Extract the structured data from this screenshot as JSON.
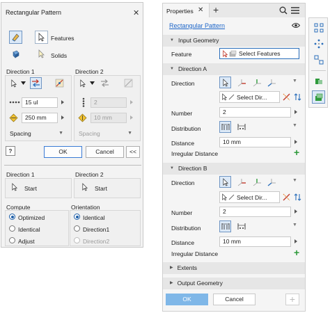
{
  "dialog": {
    "title": "Rectangular Pattern",
    "features_label": "Features",
    "solids_label": "Solids",
    "direction1": {
      "label": "Direction 1",
      "count": "15 ul",
      "spacing": "250 mm",
      "method": "Spacing"
    },
    "direction2": {
      "label": "Direction 2",
      "count": "2",
      "spacing": "10 mm",
      "method": "Spacing"
    },
    "ok_label": "OK",
    "cancel_label": "Cancel",
    "more_label": "<<",
    "start_dir1": {
      "label": "Direction 1",
      "start": "Start"
    },
    "start_dir2": {
      "label": "Direction 2",
      "start": "Start"
    },
    "compute": {
      "label": "Compute",
      "options": [
        "Optimized",
        "Identical",
        "Adjust"
      ],
      "selected": 0
    },
    "orientation": {
      "label": "Orientation",
      "options": [
        "Identical",
        "Direction1",
        "Direction2"
      ],
      "selected": 0
    }
  },
  "properties": {
    "tab_label": "Properties",
    "panel_link": "Rectangular Pattern",
    "input_geometry": {
      "header": "Input Geometry",
      "feature_label": "Feature",
      "select_label": "Select Features"
    },
    "direction_a": {
      "header": "Direction A",
      "direction_label": "Direction",
      "select_dir": "Select Dir...",
      "number_label": "Number",
      "number": "2",
      "distribution_label": "Distribution",
      "distance_label": "Distance",
      "distance": "10 mm",
      "irregular_label": "Irregular Distance"
    },
    "direction_b": {
      "header": "Direction B",
      "direction_label": "Direction",
      "select_dir": "Select Dir...",
      "number_label": "Number",
      "number": "2",
      "distribution_label": "Distribution",
      "distance_label": "Distance",
      "distance": "10 mm",
      "irregular_label": "Irregular Distance"
    },
    "extents_header": "Extents",
    "output_header": "Output Geometry",
    "ok_label": "OK",
    "cancel_label": "Cancel"
  },
  "colors": {
    "accent": "#1c65c8",
    "ok_button": "#7fb7e8",
    "add_icon": "#2e9a3b"
  },
  "icons": [
    "close-icon",
    "features-icon",
    "solids-icon",
    "pointer-icon",
    "flip-icon",
    "midplane-icon",
    "help-icon",
    "search-icon",
    "menu-icon",
    "eye-icon",
    "plus-icon",
    "add-icon",
    "axis-icon"
  ]
}
